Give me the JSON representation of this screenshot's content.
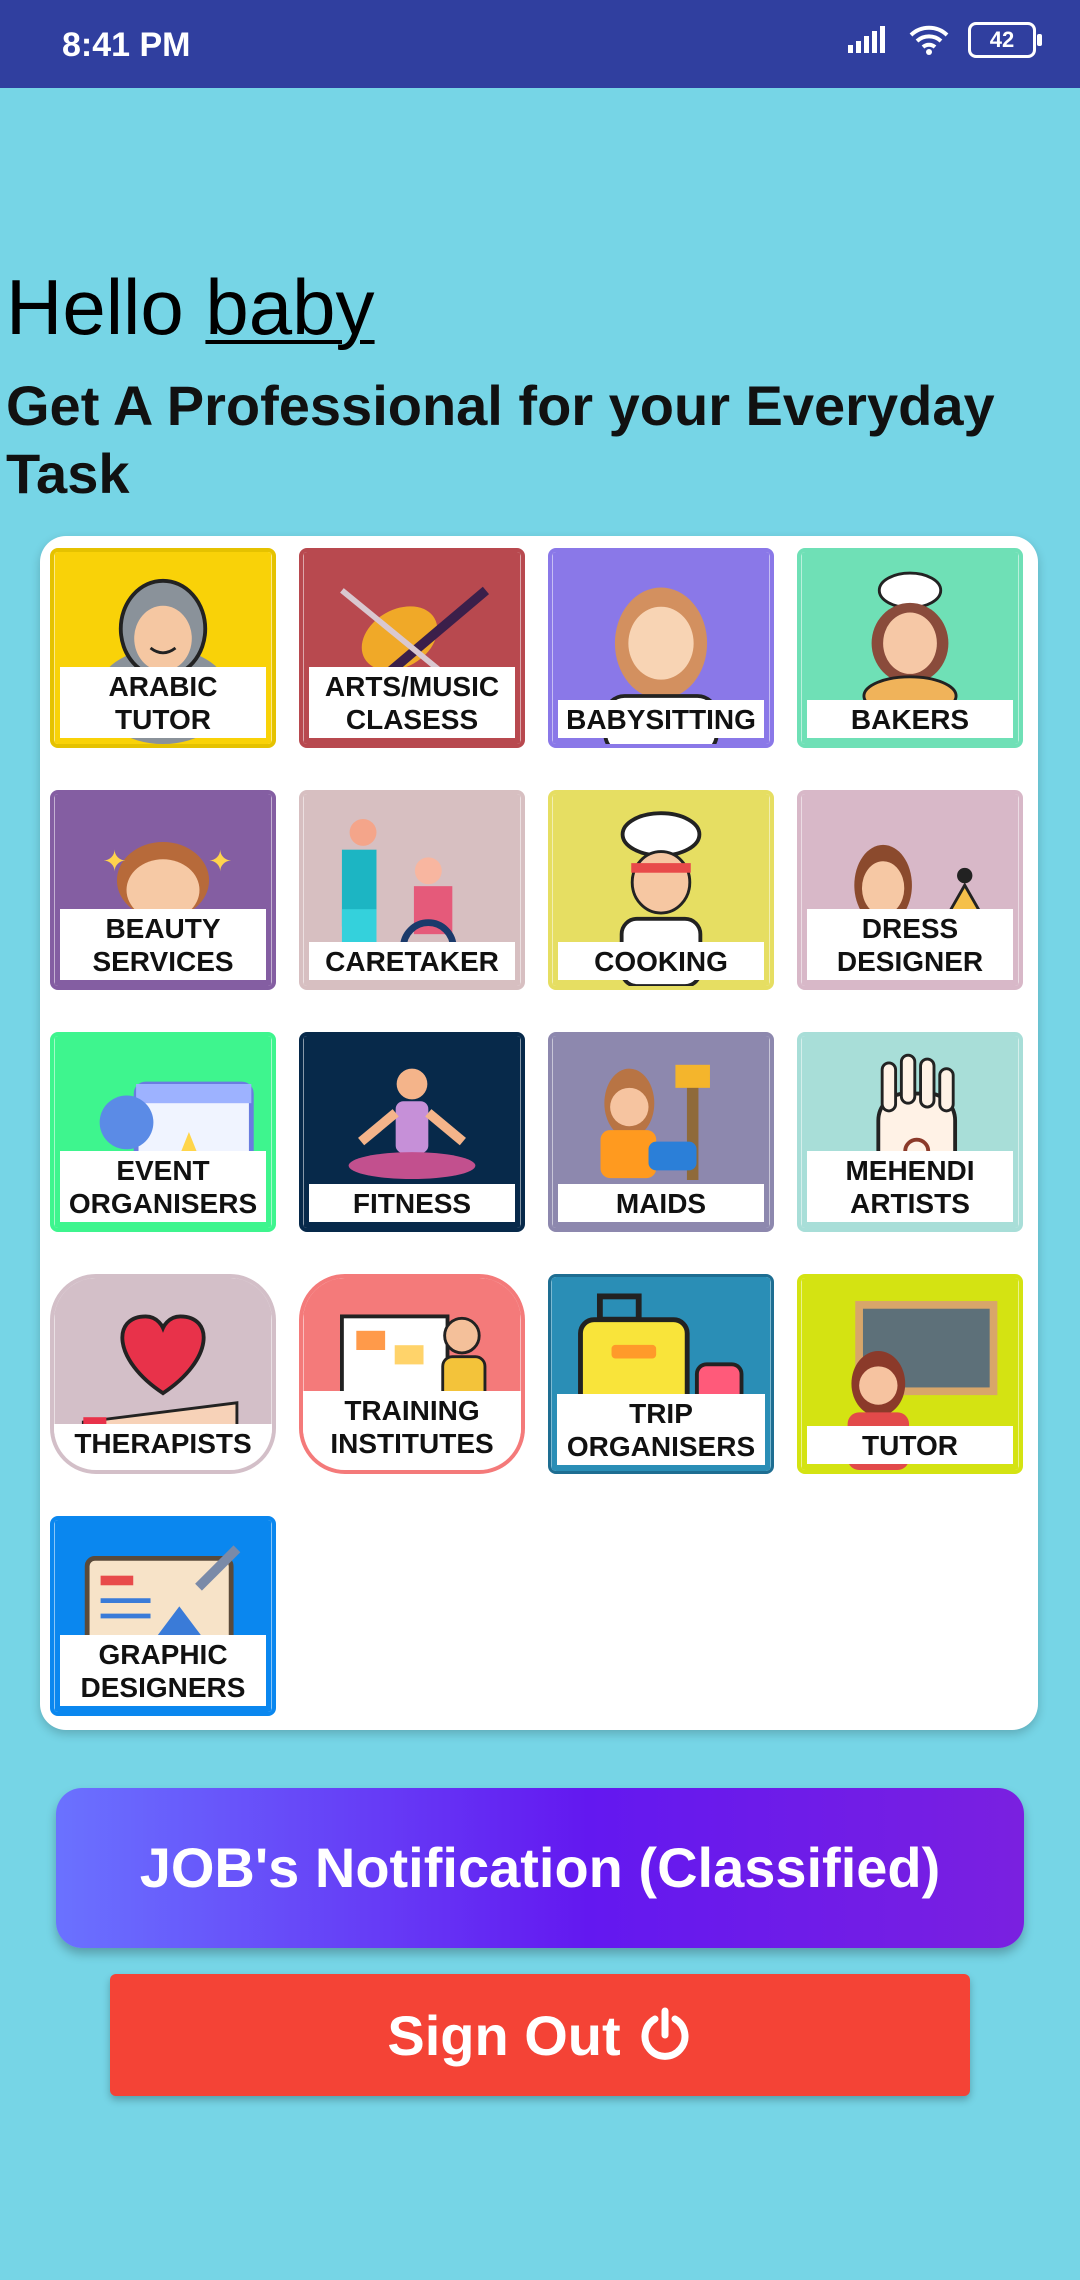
{
  "status_bar": {
    "time": "8:41 PM",
    "battery": "42"
  },
  "greeting": {
    "hello": "Hello",
    "user": "baby"
  },
  "subtitle": "Get A Professional for your Everyday Task",
  "categories": [
    {
      "label": "ARABIC TUTOR",
      "color": "#f9d208",
      "border": "#e5c200"
    },
    {
      "label": "ARTS/MUSIC CLASESS",
      "color": "#b8494f",
      "border": "#b8494f"
    },
    {
      "label": "BABYSITTING",
      "color": "#8a78e8",
      "border": "#8a78e8"
    },
    {
      "label": "BAKERS",
      "color": "#6fe0b6",
      "border": "#6fe0b6"
    },
    {
      "label": "BEAUTY SERVICES",
      "color": "#845ea2",
      "border": "#845ea2"
    },
    {
      "label": "CARETAKER",
      "color": "#d7bfc1",
      "border": "#d7bfc1"
    },
    {
      "label": "COOKING",
      "color": "#e6de62",
      "border": "#e6de62"
    },
    {
      "label": "DRESS DESIGNER",
      "color": "#d8b8c8",
      "border": "#d8b8c8"
    },
    {
      "label": "EVENT ORGANISERS",
      "color": "#3ef58e",
      "border": "#3ef58e"
    },
    {
      "label": "FITNESS",
      "color": "#07294a",
      "border": "#07294a"
    },
    {
      "label": "MAIDS",
      "color": "#8d88ae",
      "border": "#8d88ae"
    },
    {
      "label": "MEHENDI ARTISTS",
      "color": "#a8ded8",
      "border": "#a8ded8"
    },
    {
      "label": "THERAPISTS",
      "color": "#d3bfc8",
      "border": "#d3bfc8"
    },
    {
      "label": "TRAINING INSTITUTES",
      "color": "#f47a7a",
      "border": "#f47a7a"
    },
    {
      "label": "TRIP ORGANISERS",
      "color": "#2a8eb6",
      "border": "#1e6e92"
    },
    {
      "label": "TUTOR",
      "color": "#d4e312",
      "border": "#d4e312"
    },
    {
      "label": "GRAPHIC DESIGNERS",
      "color": "#0a87ef",
      "border": "#0a87ef"
    }
  ],
  "buttons": {
    "jobs": "JOB's Notification (Classified)",
    "sign_out": "Sign Out"
  },
  "icons": {
    "power": "power-icon",
    "wifi": "wifi-icon",
    "signal": "signal-icon"
  }
}
